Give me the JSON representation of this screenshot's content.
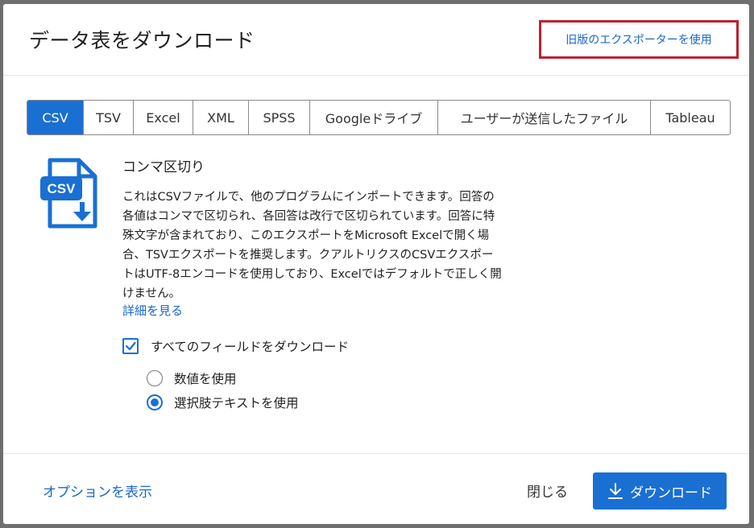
{
  "dialog": {
    "title": "データ表をダウンロード",
    "legacy_link": "旧版のエクスポーターを使用"
  },
  "tabs": [
    {
      "label": "CSV",
      "active": true
    },
    {
      "label": "TSV"
    },
    {
      "label": "Excel"
    },
    {
      "label": "XML"
    },
    {
      "label": "SPSS"
    },
    {
      "label": "Googleドライブ"
    },
    {
      "label": "ユーザーが送信したファイル"
    },
    {
      "label": "Tableau"
    }
  ],
  "content": {
    "icon_label": "CSV",
    "section_title": "コンマ区切り",
    "description_lines": [
      "これはCSVファイルで、他のプログラムにインポートできます。回答の",
      "各値はコンマで区切られ、各回答は改行で区切られています。回答に特",
      "殊文字が含まれており、このエクスポートをMicrosoft Excelで開く場",
      "合、TSVエクスポートを推奨します。クアルトリクスのCSVエクスポー",
      "トはUTF-8エンコードを使用しており、Excelではデフォルトで正しく開",
      "けません。"
    ],
    "more_link": "詳細を見る",
    "download_all_fields": {
      "label": "すべてのフィールドをダウンロード",
      "checked": true
    },
    "value_options": [
      {
        "label": "数値を使用",
        "selected": false
      },
      {
        "label": "選択肢テキストを使用",
        "selected": true
      }
    ]
  },
  "footer": {
    "show_options": "オプションを表示",
    "close": "閉じる",
    "download": "ダウンロード"
  },
  "colors": {
    "accent": "#1a6fd3",
    "link": "#1a66cc",
    "highlight_box": "#c0202f"
  }
}
